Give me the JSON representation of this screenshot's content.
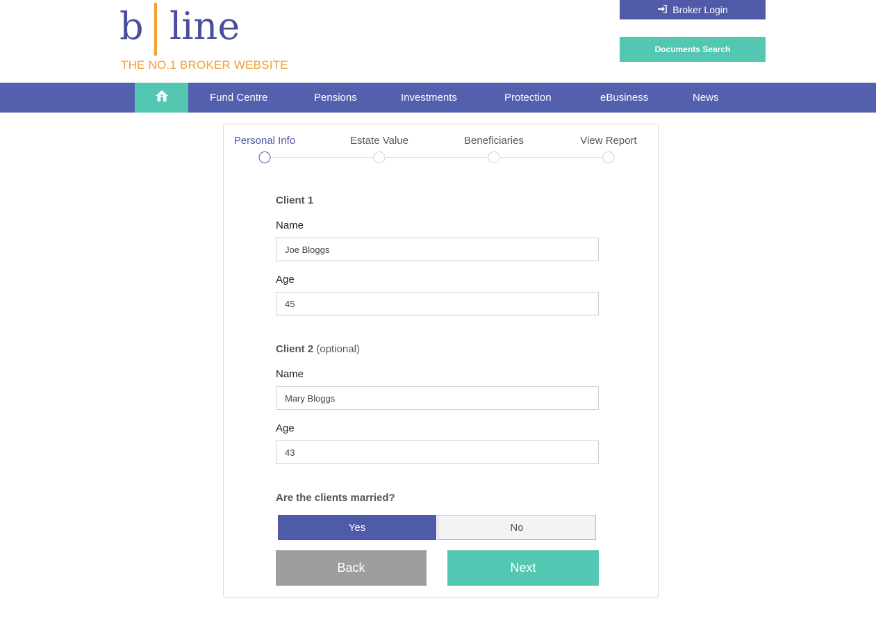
{
  "header": {
    "logo_b": "b",
    "logo_line": "line",
    "logo_tagline": "THE NO.1 BROKER WEBSITE",
    "broker_login_label": "Broker Login",
    "documents_search_label": "Documents Search"
  },
  "nav": {
    "home_icon": "home-icon",
    "items": [
      "Fund Centre",
      "Pensions",
      "Investments",
      "Protection",
      "eBusiness",
      "News"
    ]
  },
  "steps": [
    {
      "label": "Personal Info",
      "active": true
    },
    {
      "label": "Estate Value",
      "active": false
    },
    {
      "label": "Beneficiaries",
      "active": false
    },
    {
      "label": "View Report",
      "active": false
    }
  ],
  "client1": {
    "title": "Client 1",
    "name_label": "Name",
    "name_value": "Joe Bloggs",
    "age_label": "Age",
    "age_value": "45"
  },
  "client2": {
    "title": "Client 2",
    "optional": "(optional)",
    "name_label": "Name",
    "name_value": "Mary Bloggs",
    "age_label": "Age",
    "age_value": "43"
  },
  "married": {
    "question": "Are the clients married?",
    "yes_label": "Yes",
    "no_label": "No",
    "selected": "Yes"
  },
  "actions": {
    "back_label": "Back",
    "next_label": "Next"
  },
  "colors": {
    "primary": "#4f5aa8",
    "accent": "#53c7b2",
    "logo_orange": "#f0a12e",
    "back_gray": "#9e9e9e"
  }
}
